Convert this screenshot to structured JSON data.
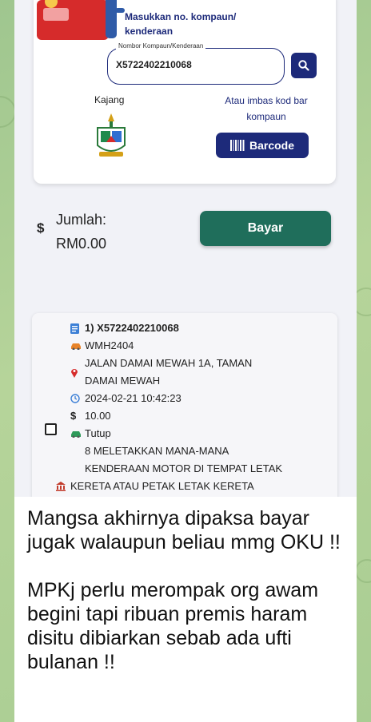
{
  "compound_search": {
    "instruction": "Masukkan no. kompaun/ kenderaan",
    "field_label": "Nombor Kompaun/Kenderaan",
    "field_value": "X5722402210068",
    "council_name": "Kajang",
    "scan_hint": "Atau imbas kod bar kompaun",
    "barcode_label": "Barcode"
  },
  "payment": {
    "currency_symbol": "$",
    "total_label": "Jumlah:",
    "total_amount": "RM0.00",
    "pay_label": "Bayar"
  },
  "compound_item": {
    "number": "1) X5722402210068",
    "plate": "WMH2404",
    "location_line1": "JALAN DAMAI MEWAH 1A, TAMAN",
    "location_line2": "DAMAI MEWAH",
    "datetime": "2024-02-21 10:42:23",
    "amount_symbol": "$",
    "amount": "10.00",
    "status": "Tutup",
    "offence_line1": "8 MELETAKKAN MANA-MANA",
    "offence_line2": "KENDERAAN MOTOR DI TEMPAT LETAK",
    "offence_line3": "KERETA ATAU PETAK LETAK KERETA"
  },
  "caption": {
    "para1": "Mangsa akhirnya dipaksa bayar jugak walaupun beliau mmg OKU !!",
    "para2": "MPKj perlu merompak org awam begini tapi ribuan premis haram disitu dibiarkan sebab ada ufti bulanan !!"
  },
  "colors": {
    "primary_navy": "#1d2a7a",
    "pay_green": "#1f6e5b",
    "chat_bg": "#a9cd93"
  },
  "icons": {
    "search": "magnifier",
    "barcode": "barcode",
    "compound_number": "document",
    "plate": "car",
    "location": "map-pin",
    "time": "clock",
    "status": "car",
    "offence": "building"
  }
}
